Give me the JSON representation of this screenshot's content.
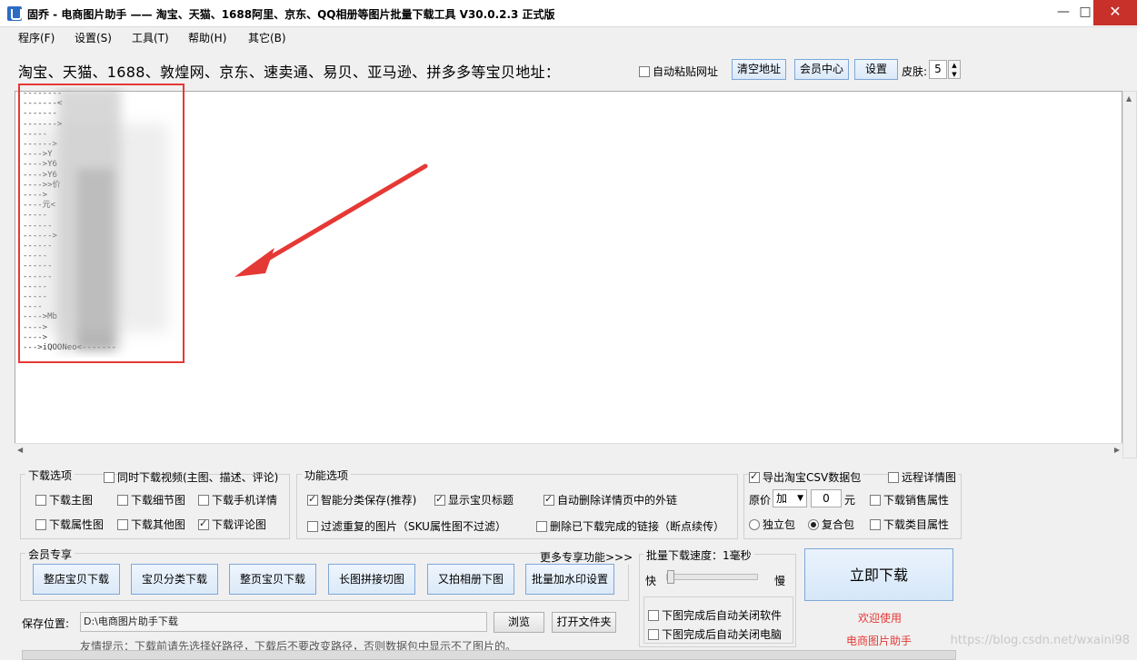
{
  "window": {
    "title": "固乔 - 电商图片助手 —— 淘宝、天猫、1688阿里、京东、QQ相册等图片批量下载工具 V30.0.2.3 正式版",
    "minimize": "—",
    "restore": "□",
    "close": "✕"
  },
  "menu": [
    "程序(F)",
    "设置(S)",
    "工具(T)",
    "帮助(H)",
    "其它(B)"
  ],
  "address": {
    "label": "淘宝、天猫、1688、敦煌网、京东、速卖通、易贝、亚马逊、拼多多等宝贝地址：",
    "auto_paste": "自动粘贴网址",
    "clear": "清空地址",
    "member": "会员中心",
    "settings": "设置",
    "skin_label": "皮肤:",
    "skin_value": "5"
  },
  "paste_text": {
    "lines": [
      "--------",
      "-------<",
      "-------",
      "------->",
      "-----",
      "------>",
      "---->Y",
      "---->Y6",
      "---->Y6",
      "---->>价",
      "---->",
      "----元<",
      "-----",
      "------",
      "------>",
      "------",
      "-----",
      "------",
      "------",
      "-----",
      "-----",
      "----",
      "---->Mb",
      "---->",
      "---->",
      "--->iQOONeo<-------"
    ]
  },
  "download_options": {
    "title": "下载选项",
    "video": "同时下载视频(主图、描述、评论)",
    "items": [
      {
        "label": "下载主图",
        "checked": false
      },
      {
        "label": "下载细节图",
        "checked": false
      },
      {
        "label": "下载手机详情",
        "checked": false
      },
      {
        "label": "下载属性图",
        "checked": false
      },
      {
        "label": "下载其他图",
        "checked": false
      },
      {
        "label": "下载评论图",
        "checked": true
      }
    ]
  },
  "function_options": {
    "title": "功能选项",
    "items": [
      {
        "label": "智能分类保存(推荐)",
        "checked": true
      },
      {
        "label": "显示宝贝标题",
        "checked": true
      },
      {
        "label": "自动删除详情页中的外链",
        "checked": true
      },
      {
        "label": "过滤重复的图片（SKU属性图不过滤）",
        "checked": false
      },
      {
        "label": "删除已下载完成的链接（断点续传）",
        "checked": false
      }
    ]
  },
  "csv": {
    "export": "导出淘宝CSV数据包",
    "remote": "远程详情图",
    "price_label": "原价",
    "price_op": "加",
    "price_value": "0",
    "unit": "元",
    "sales": "下载销售属性",
    "single": "独立包",
    "combined": "复合包",
    "category": "下载类目属性"
  },
  "member": {
    "title": "会员专享",
    "more": "更多专享功能>>>",
    "buttons": [
      "整店宝贝下载",
      "宝贝分类下载",
      "整页宝贝下载",
      "长图拼接切图",
      "又拍相册下图",
      "批量加水印设置"
    ]
  },
  "speed": {
    "title": "批量下载速度：1毫秒",
    "fast": "快",
    "slow": "慢",
    "value_fraction": 0.0,
    "close_app": "下图完成后自动关闭软件",
    "shutdown": "下图完成后自动关闭电脑"
  },
  "download_now": "立即下载",
  "welcome1": "欢迎使用",
  "welcome2": "电商图片助手",
  "save": {
    "label": "保存位置:",
    "path": "D:\\电商图片助手下载",
    "browse": "浏览",
    "open": "打开文件夹",
    "tip": "友情提示：下载前请先选择好路径，下载后不要改变路径，否则数据包中显示不了图片的。"
  },
  "watermark": "https://blog.csdn.net/wxaini98",
  "colors": {
    "accent": "#2b6cc4",
    "highlight": "#e53935",
    "close": "#c8302a"
  }
}
